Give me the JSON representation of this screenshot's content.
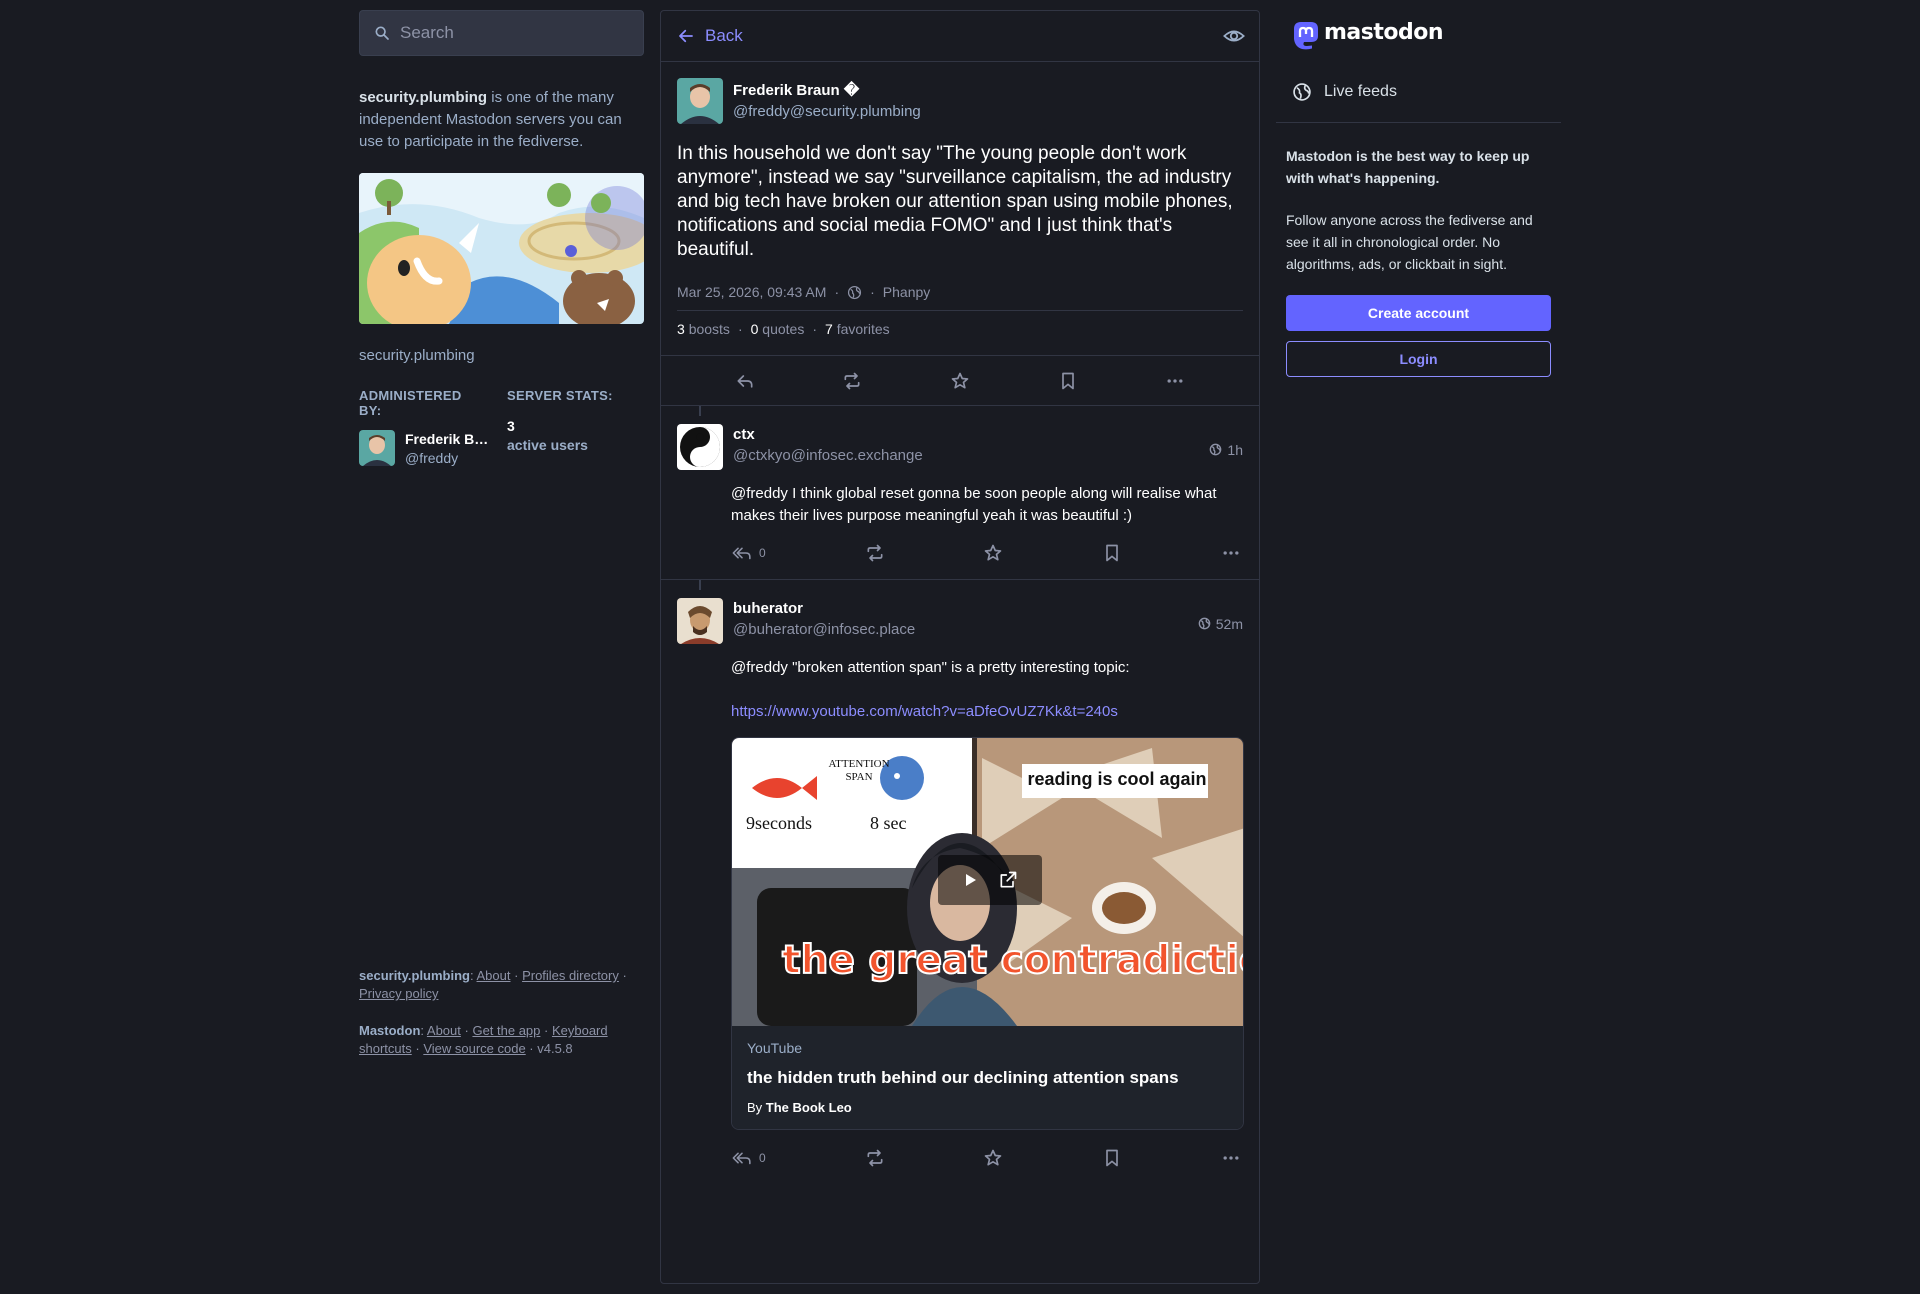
{
  "search": {
    "placeholder": "Search"
  },
  "server": {
    "domain_bold": "security.plumbing",
    "description_rest": " is one of the many independent Mastodon servers you can use to participate in the fediverse.",
    "domain": "security.plumbing",
    "administered_label": "ADMINISTERED BY:",
    "stats_label": "SERVER STATS:",
    "admin_name": "Frederik Braun",
    "admin_handle": "@freddy",
    "active_users": "3",
    "active_users_label": "active users"
  },
  "footer": {
    "server_label": "security.plumbing",
    "about": "About",
    "profiles": "Profiles directory",
    "privacy": "Privacy policy",
    "mastodon_label": "Mastodon",
    "m_about": "About",
    "get_app": "Get the app",
    "shortcuts": "Keyboard shortcuts",
    "source": "View source code",
    "version": "v4.5.8"
  },
  "header": {
    "back_label": "Back"
  },
  "main_status": {
    "display_name": "Frederik Braun �",
    "handle": "@freddy@security.plumbing",
    "content": "In this household we don't say \"The young people don't work anymore\", instead we say \"surveillance capitalism, the ad industry and big tech have broken our attention span using mobile phones, notifications and social media FOMO\" and I just think that's beautiful.",
    "timestamp": "Mar 25, 2026, 09:43 AM",
    "app": "Phanpy",
    "boosts": "3",
    "boosts_label": "boosts",
    "quotes": "0",
    "quotes_label": "quotes",
    "favorites": "7",
    "favorites_label": "favorites"
  },
  "replies": [
    {
      "display_name": "ctx",
      "handle": "@ctxkyo@infosec.exchange",
      "time": "1h",
      "content": "@freddy I think global reset gonna be soon people along will realise what makes their lives purpose meaningful yeah it was beautiful :)",
      "reply_count": "0"
    },
    {
      "display_name": "buherator",
      "handle": "@buherator@infosec.place",
      "time": "52m",
      "content": "@freddy \"broken attention span\" is a pretty interesting topic:",
      "link": "https://www.youtube.com/watch?v=aDfeOvUZ7Kk&t=240s",
      "reply_count": "0",
      "card": {
        "provider": "YouTube",
        "title": "the hidden truth behind our declining attention spans",
        "author_prefix": "By ",
        "author": "The Book Leo",
        "thumb_text_top": "reading is cool again",
        "thumb_text_main": "the great contradiction",
        "thumb_attention": "ATTENTION SPAN",
        "thumb_9": "9seconds",
        "thumb_8": "8 sec"
      }
    }
  ],
  "sidebar": {
    "live_feeds": "Live feeds",
    "promo_title": "Mastodon is the best way to keep up with what's happening.",
    "promo_text": "Follow anyone across the fediverse and see it all in chronological order. No algorithms, ads, or clickbait in sight.",
    "create_account": "Create account",
    "login": "Login",
    "logo_text": "mastodon"
  },
  "colors": {
    "accent": "#6364ff",
    "link": "#8c8dff",
    "bg": "#191b22"
  }
}
